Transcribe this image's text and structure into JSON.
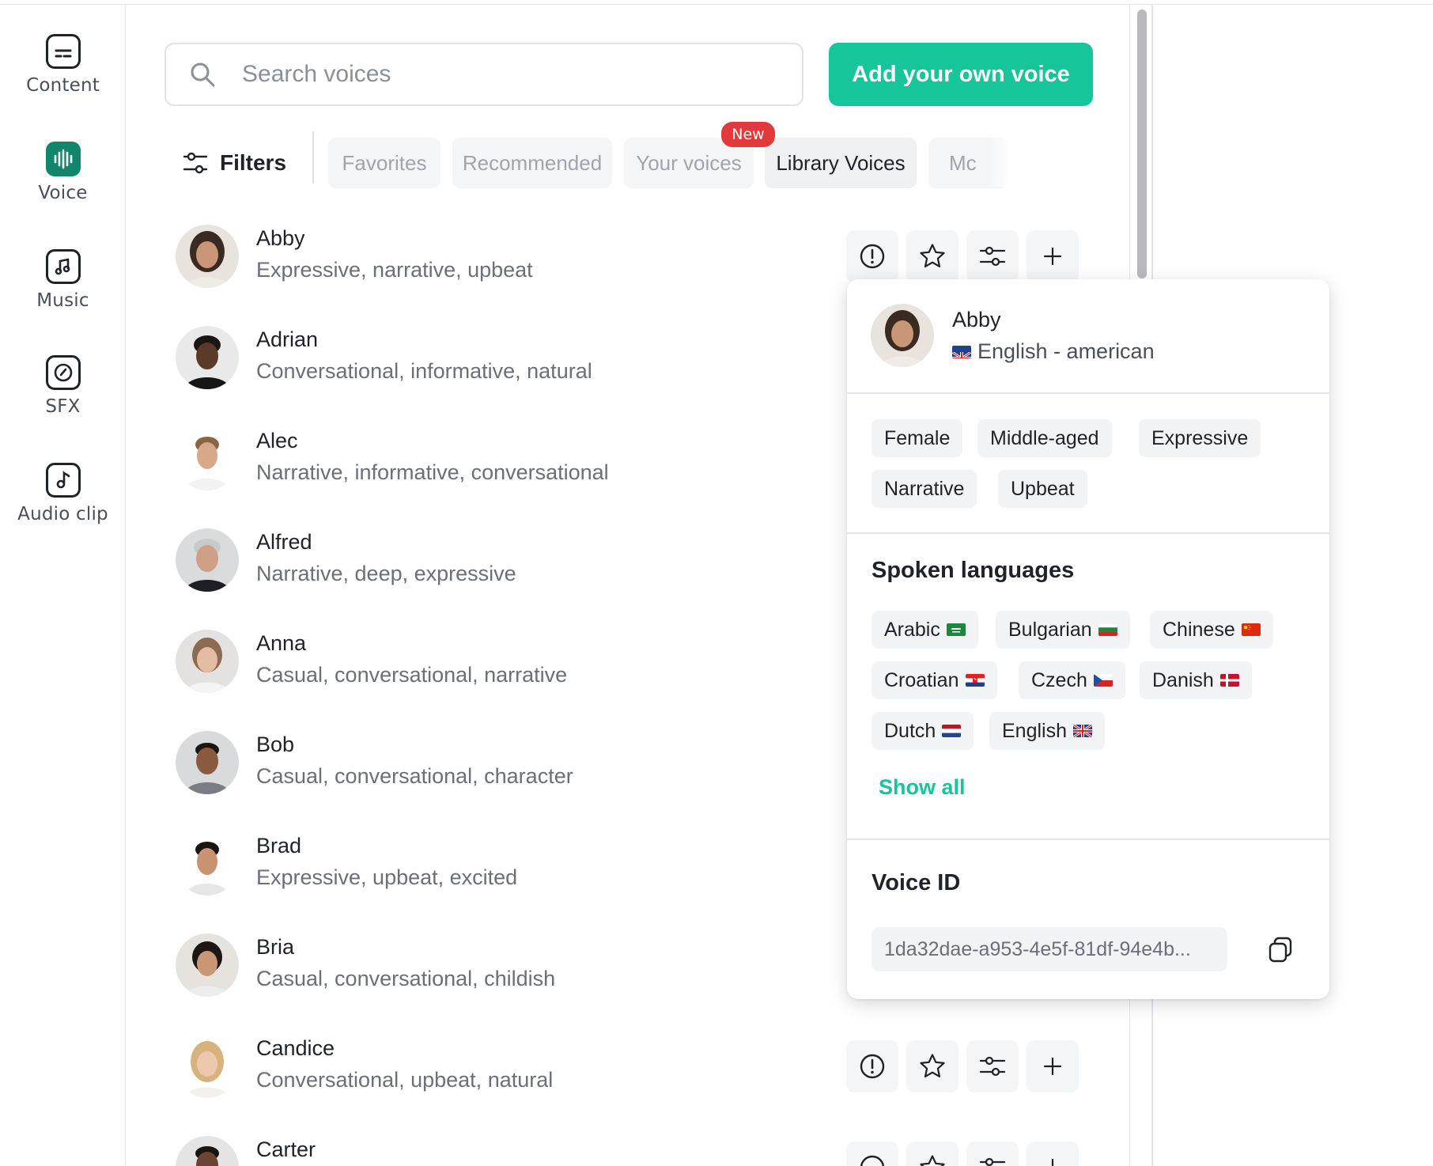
{
  "sidebar": {
    "items": [
      {
        "label": "Content",
        "icon": "content-icon",
        "active": false
      },
      {
        "label": "Voice",
        "icon": "voice-waveform-icon",
        "active": true
      },
      {
        "label": "Music",
        "icon": "music-icon",
        "active": false
      },
      {
        "label": "SFX",
        "icon": "sfx-icon",
        "active": false
      },
      {
        "label": "Audio clip",
        "icon": "audio-clip-icon",
        "active": false
      }
    ]
  },
  "search": {
    "placeholder": "Search voices",
    "value": ""
  },
  "add_voice_label": "Add your own voice",
  "filters": {
    "label": "Filters",
    "tabs": [
      {
        "label": "Favorites",
        "selected": false
      },
      {
        "label": "Recommended",
        "selected": false,
        "badge": "New"
      },
      {
        "label": "Your voices",
        "selected": false
      },
      {
        "label": "Library Voices",
        "selected": true
      },
      {
        "label": "Mc",
        "selected": false
      }
    ]
  },
  "voices": [
    {
      "name": "Abby",
      "description": "Expressive, narrative, upbeat"
    },
    {
      "name": "Adrian",
      "description": "Conversational, informative, natural"
    },
    {
      "name": "Alec",
      "description": "Narrative, informative, conversational"
    },
    {
      "name": "Alfred",
      "description": "Narrative, deep, expressive"
    },
    {
      "name": "Anna",
      "description": "Casual, conversational, narrative"
    },
    {
      "name": "Bob",
      "description": "Casual, conversational, character"
    },
    {
      "name": "Brad",
      "description": "Expressive, upbeat, excited"
    },
    {
      "name": "Bria",
      "description": "Casual, conversational, childish"
    },
    {
      "name": "Candice",
      "description": "Conversational, upbeat, natural"
    },
    {
      "name": "Carter",
      "description": ""
    }
  ],
  "popover": {
    "name": "Abby",
    "language": "English - american",
    "tags": [
      "Female",
      "Middle-aged",
      "Expressive",
      "Narrative",
      "Upbeat"
    ],
    "spoken_languages_title": "Spoken languages",
    "languages": [
      "Arabic",
      "Bulgarian",
      "Chinese",
      "Croatian",
      "Czech",
      "Danish",
      "Dutch",
      "English"
    ],
    "show_all": "Show all",
    "voice_id_title": "Voice ID",
    "voice_id": "1da32dae-a953-4e5f-81df-94e4b..."
  },
  "colors": {
    "accent": "#17c59a",
    "active_icon": "#12866a",
    "badge": "#e23a3a"
  }
}
